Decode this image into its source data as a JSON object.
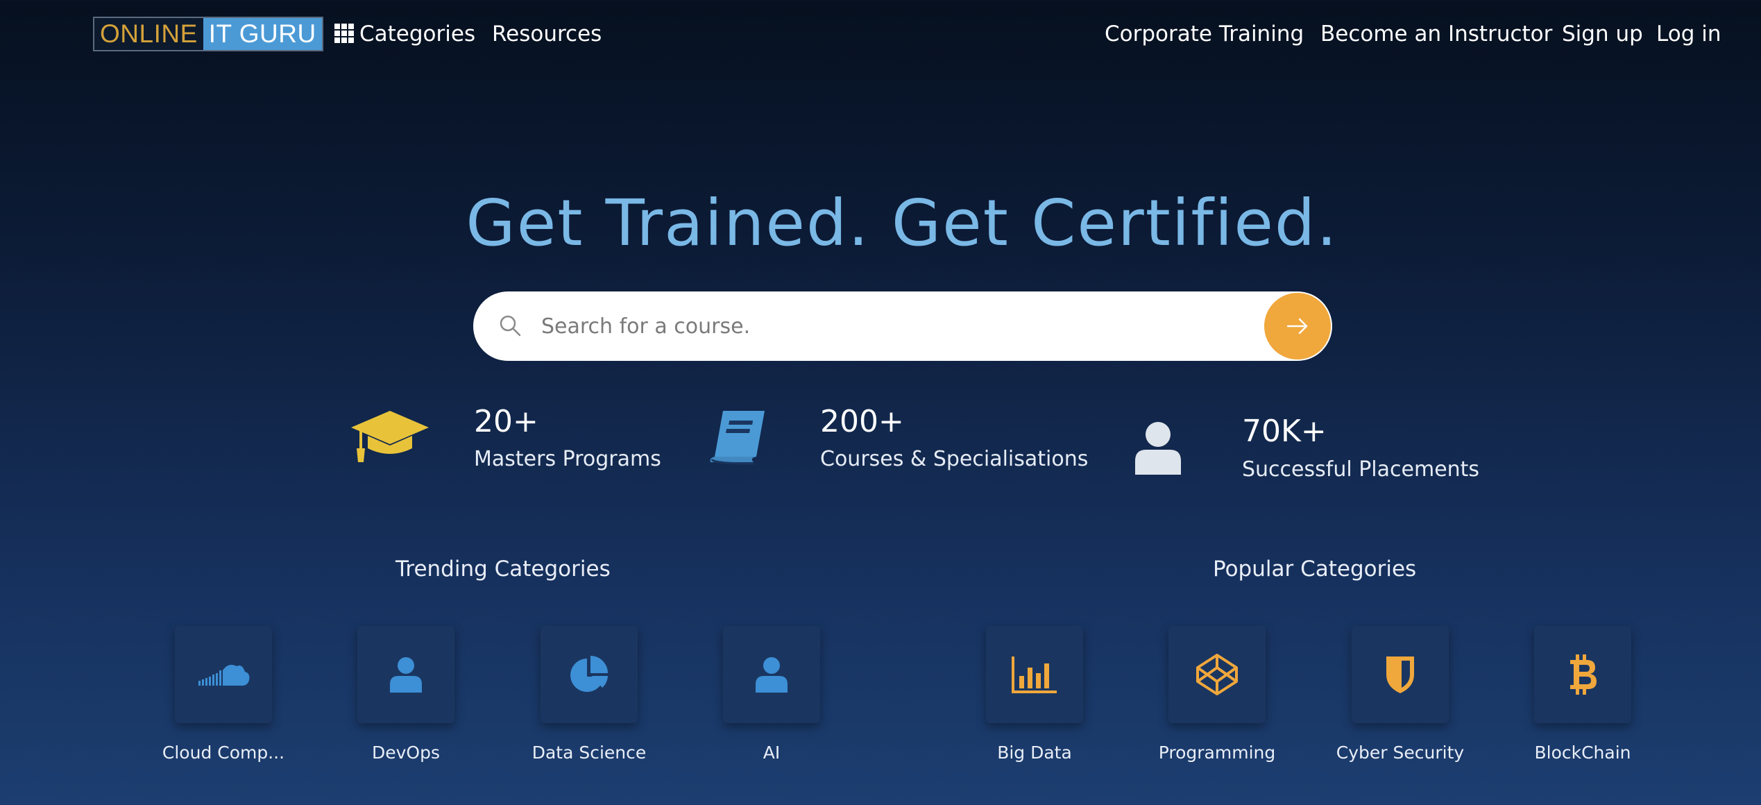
{
  "header": {
    "logo_part1": "ONLINE",
    "logo_part2": "IT GURU",
    "nav_left": [
      "Categories",
      "Resources"
    ],
    "nav_right": [
      "Corporate Training",
      "Become an Instructor",
      "Sign up",
      "Log in"
    ]
  },
  "hero": {
    "title": "Get Trained. Get Certified.",
    "search_placeholder": "Search for a course."
  },
  "stats": [
    {
      "value": "20+",
      "label": "Masters Programs",
      "icon": "graduation-cap-icon"
    },
    {
      "value": "200+",
      "label": "Courses & Specialisations",
      "icon": "book-icon"
    },
    {
      "value": "70K+",
      "label": "Successful Placements",
      "icon": "user-icon"
    }
  ],
  "trending": {
    "heading": "Trending Categories",
    "items": [
      {
        "label": "Cloud Comp...",
        "icon": "cloud-icon"
      },
      {
        "label": "DevOps",
        "icon": "user-icon"
      },
      {
        "label": "Data Science",
        "icon": "pie-chart-icon"
      },
      {
        "label": "AI",
        "icon": "user-icon"
      }
    ]
  },
  "popular": {
    "heading": "Popular Categories",
    "items": [
      {
        "label": "Big Data",
        "icon": "bar-chart-icon"
      },
      {
        "label": "Programming",
        "icon": "codepen-icon"
      },
      {
        "label": "Cyber Security",
        "icon": "shield-icon"
      },
      {
        "label": "BlockChain",
        "icon": "bitcoin-icon"
      }
    ]
  },
  "colors": {
    "accent_orange": "#f0a73c",
    "accent_blue": "#4b9ad6",
    "title_blue": "#7ab8e6",
    "cap_yellow": "#e8c33a"
  }
}
